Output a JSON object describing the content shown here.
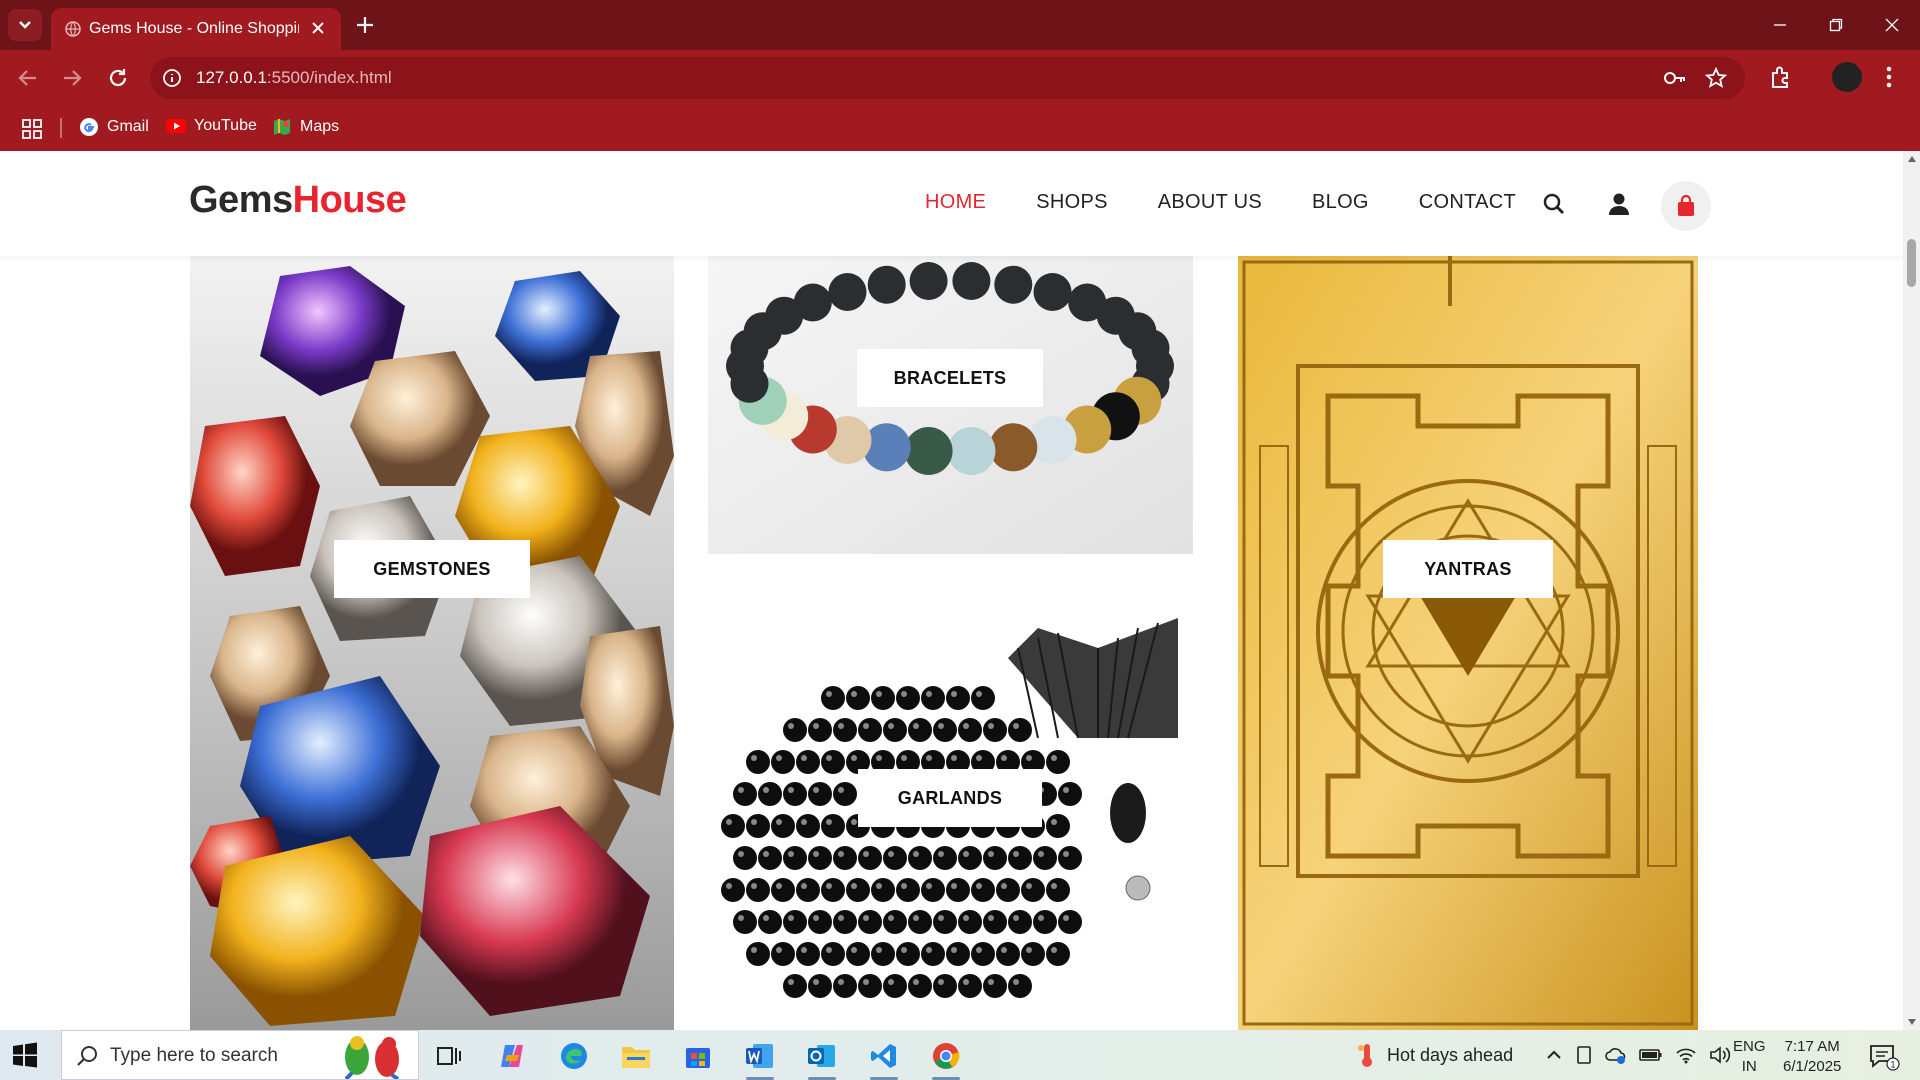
{
  "browser": {
    "tab_title": "Gems House - Online Shopping",
    "url_host": "127.0.0.1",
    "url_rest": ":5500/index.html",
    "bookmarks": [
      "Gmail",
      "YouTube",
      "Maps"
    ]
  },
  "site": {
    "logo_part1": "Gems",
    "logo_part2": "House",
    "nav": [
      "HOME",
      "SHOPS",
      "ABOUT US",
      "BLOG",
      "CONTACT"
    ],
    "active_nav": "HOME",
    "accent_color": "#e8252f"
  },
  "categories": [
    {
      "label": "GEMSTONES"
    },
    {
      "label": "BRACELETS"
    },
    {
      "label": "GARLANDS"
    },
    {
      "label": "YANTRAS"
    }
  ],
  "taskbar": {
    "search_placeholder": "Type here to search",
    "weather": "Hot days ahead",
    "lang_line1": "ENG",
    "lang_line2": "IN",
    "time": "7:17 AM",
    "date": "6/1/2025",
    "notification_count": "1"
  }
}
